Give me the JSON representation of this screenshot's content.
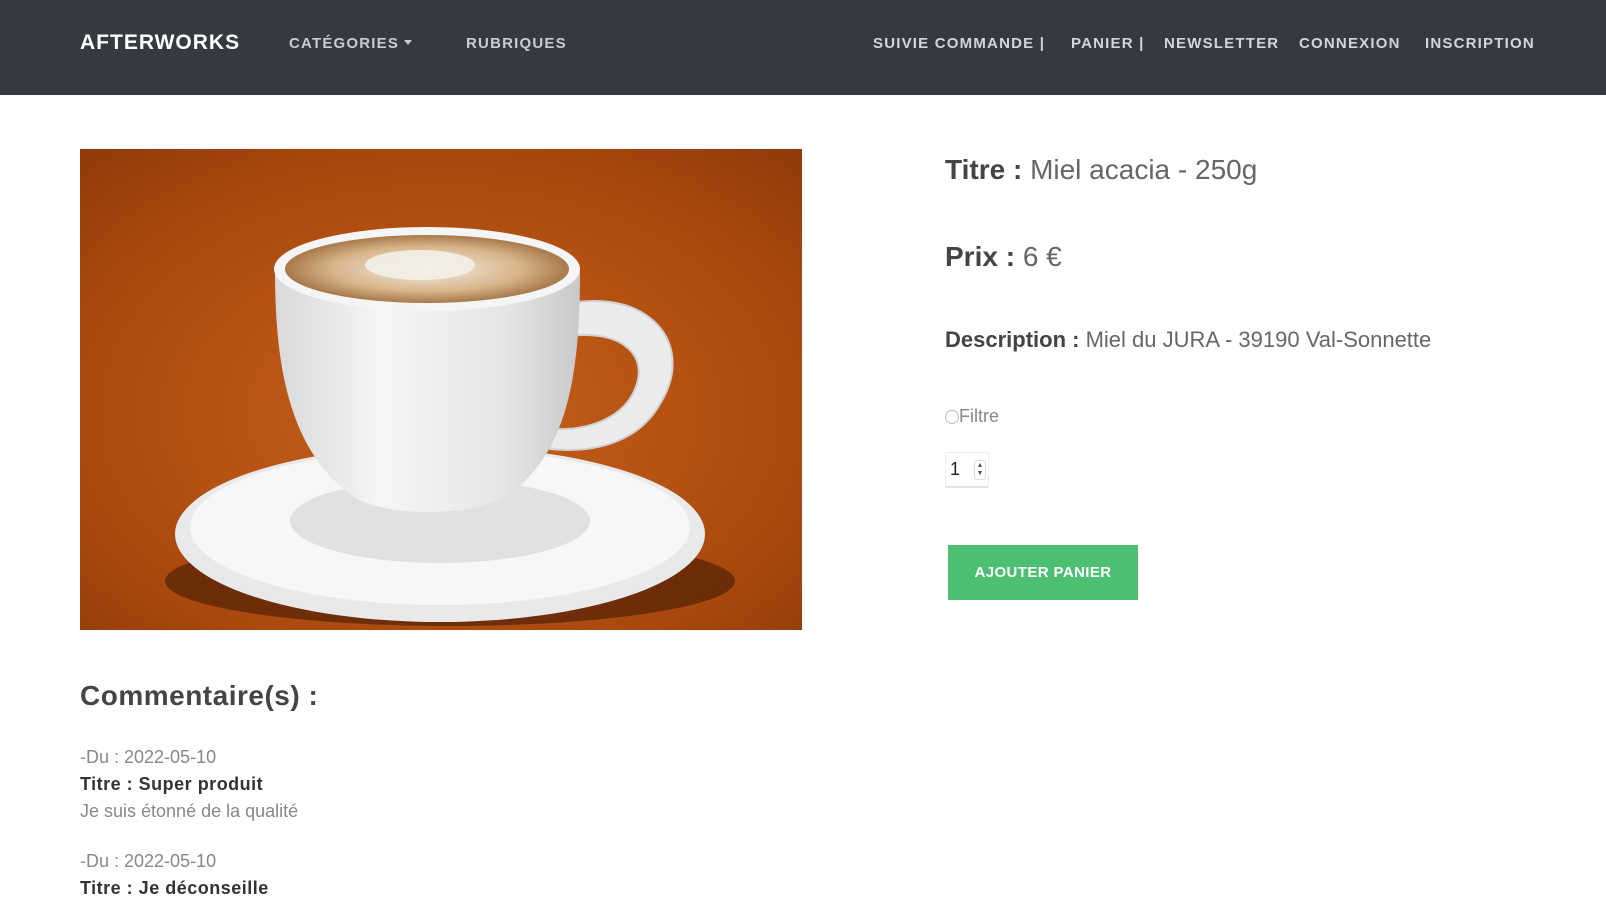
{
  "nav": {
    "brand": "AFTERWORKS",
    "categories": "CATÉGORIES",
    "rubriques": "RUBRIQUES",
    "suivie_commande": "SUIVIE COMMANDE |",
    "panier": "PANIER |",
    "newsletter": "NEWSLETTER",
    "connexion": "CONNEXION",
    "inscription": "INSCRIPTION"
  },
  "product": {
    "image_icon": "coffee-cup-image",
    "title_label": "Titre :",
    "title": "Miel acacia - 250g",
    "price_label": "Prix :",
    "price": "6 €",
    "description_label": "Description :",
    "description": "Miel du JURA - 39190 Val-Sonnette",
    "option_label": "Filtre",
    "quantity": "1",
    "add_button": "AJOUTER PANIER"
  },
  "comments": {
    "heading": "Commentaire(s) :",
    "items": [
      {
        "date": "-Du : 2022-05-10",
        "title": "Titre : Super produit",
        "text": "Je suis étonné de la qualité"
      },
      {
        "date": "-Du : 2022-05-10",
        "title": "Titre : Je déconseille",
        "text": ""
      }
    ]
  },
  "colors": {
    "navbar": "#343a40",
    "button": "#4cbf72",
    "image_background": "#b04e10"
  }
}
